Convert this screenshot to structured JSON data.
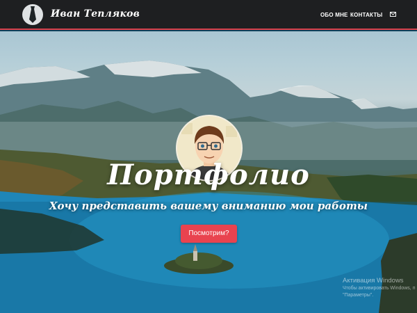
{
  "header": {
    "brand_name": "Иван Тепляков",
    "logo_icon": "tie-icon",
    "nav": [
      {
        "label": "ОБО МНЕ"
      },
      {
        "label": "КОНТАКТЫ"
      }
    ],
    "mail_icon": "envelope-icon",
    "accent_color": "#d9414b",
    "background_color": "#1e1f21"
  },
  "hero": {
    "title": "Портфолио",
    "subtitle": "Хочу представить вашему вниманию мои работы",
    "cta_label": "Посмотрим?",
    "cta_color": "#e9434f",
    "avatar_icon": "cartoon-man-avatar"
  },
  "watermark": {
    "title": "Активация Windows",
    "line1": "Чтобы активировать Windows, п",
    "line2": "\"Параметры\"."
  }
}
